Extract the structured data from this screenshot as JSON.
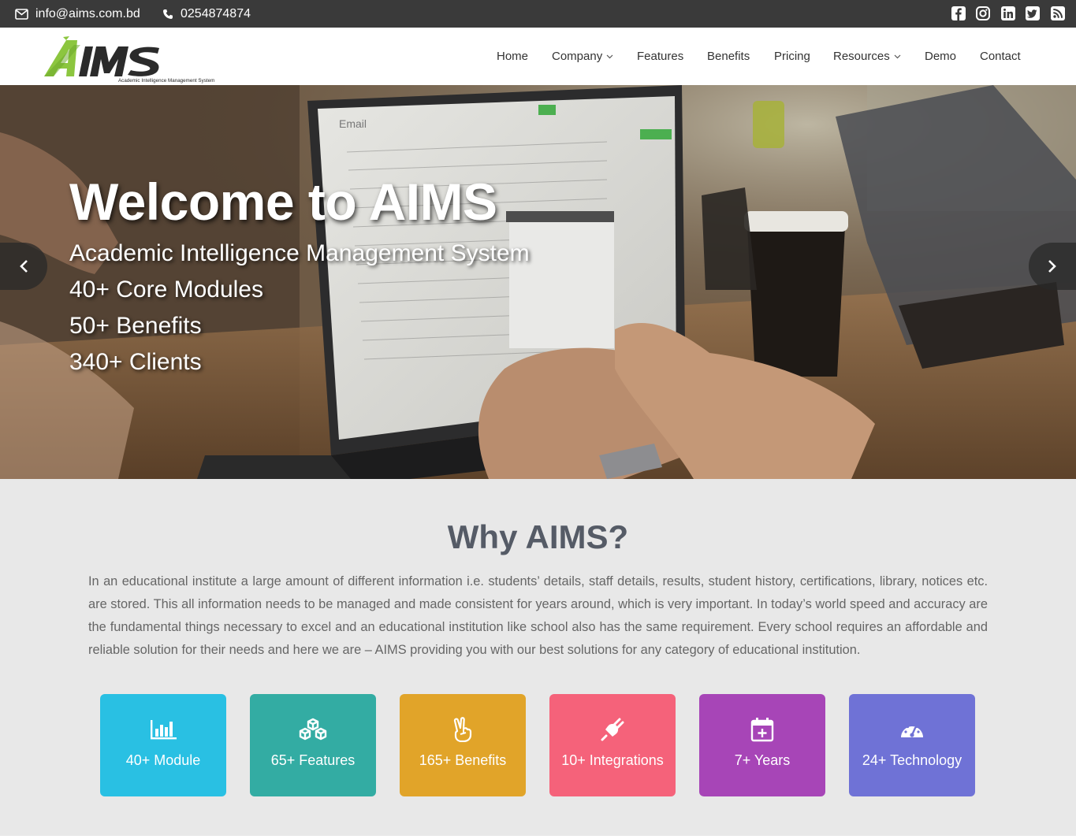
{
  "topbar": {
    "email": "info@aims.com.bd",
    "phone": "0254874874",
    "social_icons": [
      "facebook-icon",
      "instagram-icon",
      "linkedin-icon",
      "twitter-icon",
      "rss-icon"
    ]
  },
  "logo": {
    "text": "AIMS",
    "tagline": "Academic Intelligence Management System",
    "colors": {
      "a": "#8cc63f",
      "ims": "#2b2b2b"
    }
  },
  "nav": {
    "items": [
      {
        "label": "Home",
        "dropdown": false
      },
      {
        "label": "Company",
        "dropdown": true
      },
      {
        "label": "Features",
        "dropdown": false
      },
      {
        "label": "Benefits",
        "dropdown": false
      },
      {
        "label": "Pricing",
        "dropdown": false
      },
      {
        "label": "Resources",
        "dropdown": true
      },
      {
        "label": "Demo",
        "dropdown": false
      },
      {
        "label": "Contact",
        "dropdown": false
      }
    ]
  },
  "hero": {
    "title": "Welcome to AIMS",
    "lines": [
      "Academic Intelligence Management System",
      "40+ Core Modules",
      "50+ Benefits",
      "340+ Clients"
    ],
    "screen_label": "Email"
  },
  "why": {
    "title": "Why AIMS?",
    "text": "In an educational institute a large amount of different information i.e. students’ details, staff details, results, student history, certifications, library, notices etc. are stored. This all information needs to be managed and made consistent for years around, which is very important. In today’s world speed and accuracy are the fundamental things necessary to excel and an educational institution like school also has the same requirement. Every school requires an affordable and reliable solution for their needs and here we are – AIMS providing you with our best solutions for any category of educational institution."
  },
  "stats": [
    {
      "label": "40+ Module",
      "icon": "bar-chart-icon",
      "color": "#29c0e3"
    },
    {
      "label": "65+ Features",
      "icon": "cubes-icon",
      "color": "#33aca3"
    },
    {
      "label": "165+ Benefits",
      "icon": "hand-peace-icon",
      "color": "#e1a429"
    },
    {
      "label": "10+ Integrations",
      "icon": "plug-icon",
      "color": "#f5627a"
    },
    {
      "label": "7+ Years",
      "icon": "calendar-plus-icon",
      "color": "#a745b7"
    },
    {
      "label": "24+ Technology",
      "icon": "dashboard-icon",
      "color": "#6f72d6"
    }
  ]
}
